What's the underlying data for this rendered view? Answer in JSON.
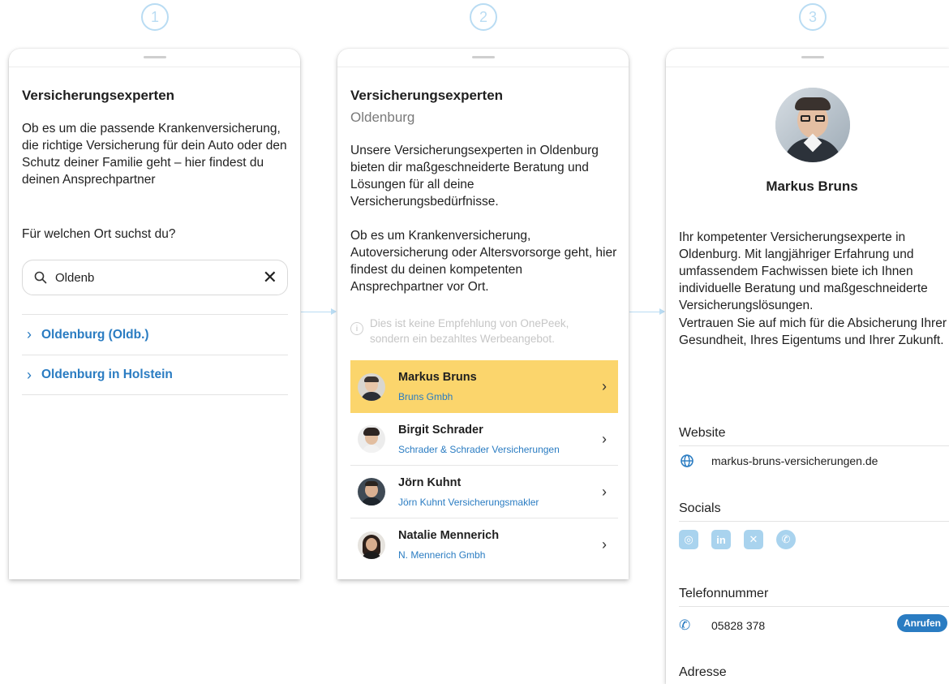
{
  "steps": [
    "1",
    "2",
    "3"
  ],
  "panel1": {
    "title": "Versicherungsexperten",
    "intro": "Ob es um die passende Krankenversicherung, die richtige Versicherung für dein Auto oder den Schutz deiner Familie geht – hier findest du deinen Ansprechpartner",
    "question": "Für welchen Ort suchst du?",
    "search_value": "Oldenb",
    "results": [
      "Oldenburg (Oldb.)",
      "Oldenburg in Holstein"
    ]
  },
  "panel2": {
    "title": "Versicherungsexperten",
    "subtitle": "Oldenburg",
    "text1": "Unsere Versicherungsexperten in Oldenburg bieten dir maßgeschneiderte Beratung und Lösungen für all deine Versicherungsbedürfnisse.",
    "text2": "Ob es um Krankenversicherung, Autoversicherung oder Altersvorsorge geht, hier findest du deinen kompetenten Ansprechpartner vor Ort.",
    "disclaimer": "Dies ist keine Empfehlung von OnePeek, sondern ein bezahltes Werbeangebot.",
    "experts": [
      {
        "name": "Markus Bruns",
        "company": "Bruns Gmbh"
      },
      {
        "name": "Birgit Schrader",
        "company": "Schrader & Schrader Versicherungen"
      },
      {
        "name": "Jörn Kuhnt",
        "company": "Jörn Kuhnt Versicherungsmakler"
      },
      {
        "name": "Natalie Mennerich",
        "company": "N. Mennerich Gmbh"
      }
    ]
  },
  "panel3": {
    "name": "Markus Bruns",
    "bio1": "Ihr kompetenter Versicherungsexperte in Oldenburg. Mit langjähriger Erfahrung und umfassendem Fachwissen biete ich Ihnen individuelle Beratung und maßgeschneiderte Versicherungslösungen.",
    "bio2": "Vertrauen Sie auf mich für die Absicherung Ihrer Gesundheit, Ihres Eigentums und Ihrer Zukunft.",
    "website_heading": "Website",
    "website": "markus-bruns-versicherungen.de",
    "socials_heading": "Socials",
    "socials": [
      "instagram-icon",
      "linkedin-icon",
      "xing-icon",
      "whatsapp-icon"
    ],
    "phone_heading": "Telefonnummer",
    "phone": "05828 378",
    "call_label": "Anrufen",
    "address_heading": "Adresse"
  },
  "colors": {
    "accent": "#2a7cc2",
    "highlight": "#fbd56c",
    "step": "#b9dcf3"
  }
}
